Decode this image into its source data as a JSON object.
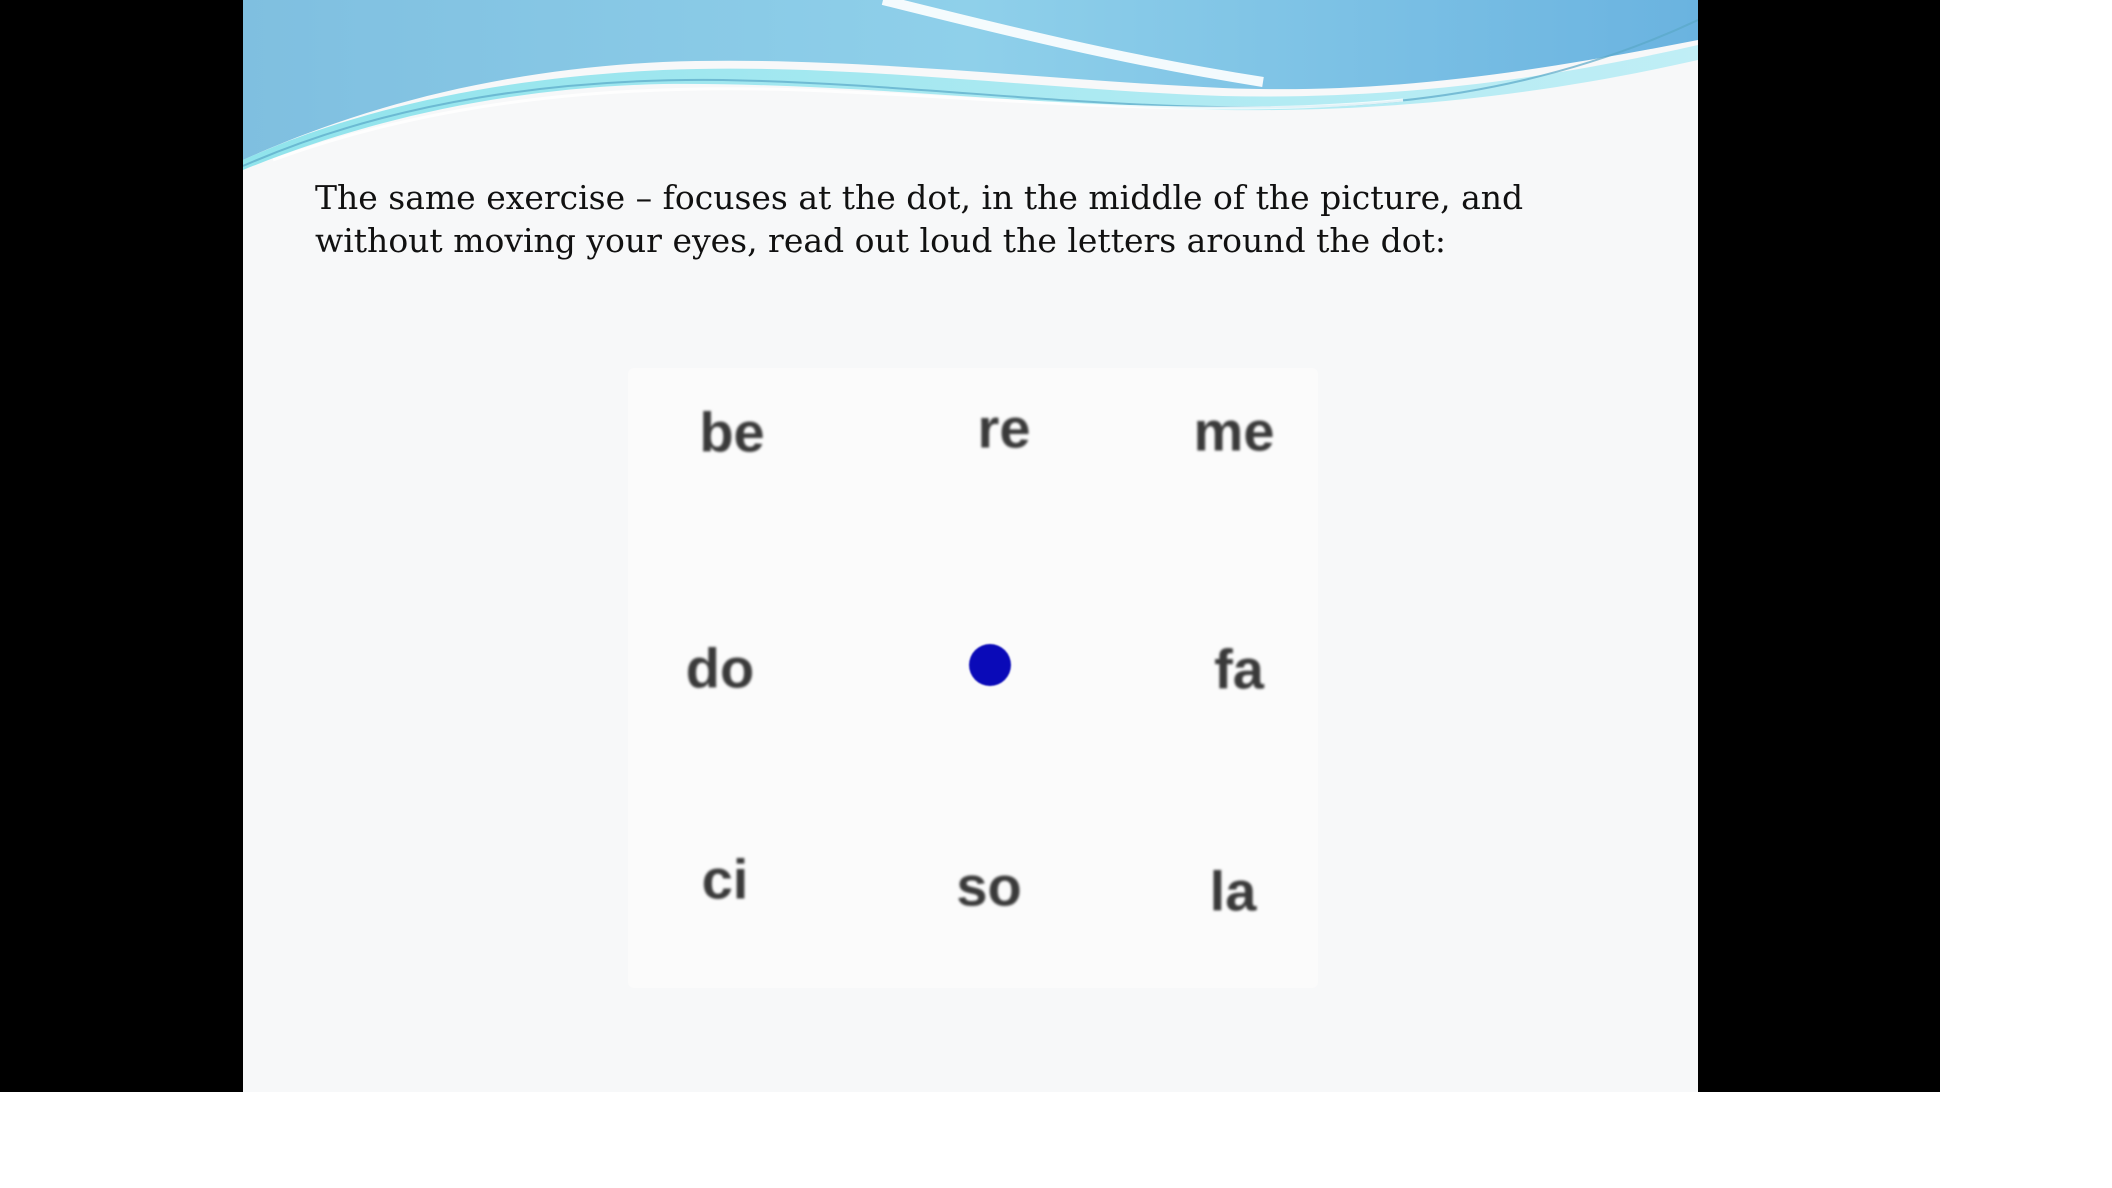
{
  "slide": {
    "instruction": "The same exercise – focuses at the dot, in the middle of the picture, and without moving your eyes, read out loud the letters around the dot:"
  },
  "exercise": {
    "rows": [
      [
        "be",
        "re",
        "me"
      ],
      [
        "do",
        "",
        "fa"
      ],
      [
        "ci",
        "so",
        "la"
      ]
    ],
    "dot_color": "#0a0ab8",
    "text_color": "#3a3a3a"
  },
  "colors": {
    "wave_dark": "#6fb6d9",
    "wave_light": "#a9def0",
    "frame": "#000000",
    "slide_bg": "#f7f8f9"
  }
}
